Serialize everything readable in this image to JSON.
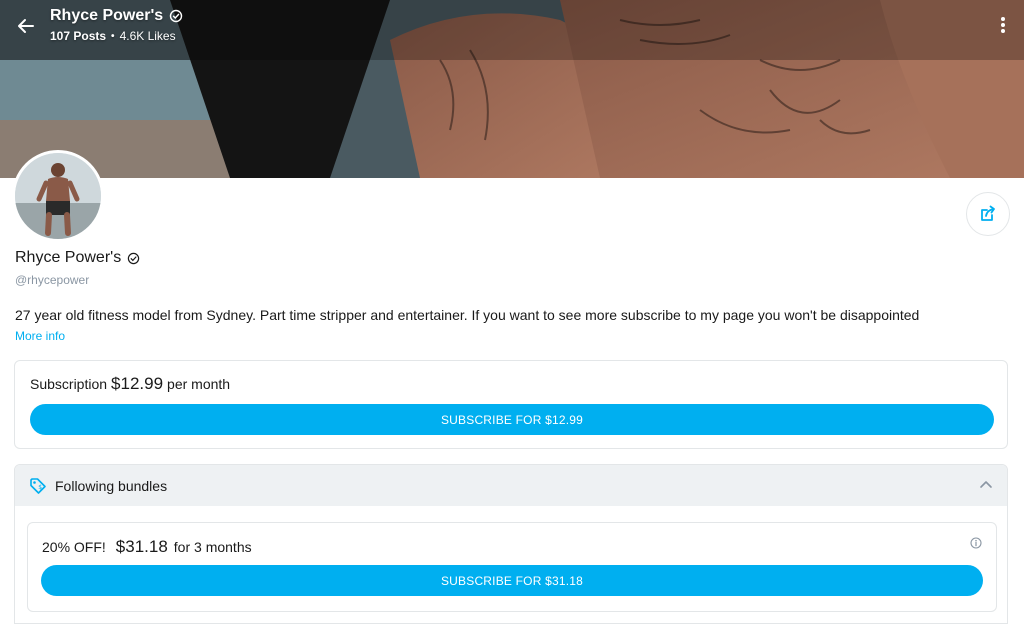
{
  "header": {
    "title": "Rhyce Power's",
    "posts": "107 Posts",
    "likes": "4.6K Likes",
    "separator": "•"
  },
  "profile": {
    "name": "Rhyce Power's",
    "handle": "@rhycepower",
    "bio": "27 year old fitness model from Sydney. Part time stripper and entertainer. If you want to see more subscribe to my page you won't be disappointed",
    "more_info": "More info"
  },
  "subscription": {
    "label": "Subscription",
    "price": "$12.99",
    "period": "per month",
    "button": "SUBSCRIBE FOR $12.99"
  },
  "bundles": {
    "title": "Following bundles",
    "items": [
      {
        "discount": "20% OFF!",
        "price": "$31.18",
        "duration": "for 3 months",
        "button": "SUBSCRIBE FOR $31.18"
      }
    ]
  },
  "colors": {
    "accent": "#00aff0",
    "text": "#1a1a1a",
    "muted": "#8a96a3",
    "border": "#e3e6e8",
    "panel": "#eef1f3"
  },
  "icons": [
    "arrow-left-icon",
    "verified-icon",
    "more-vertical-icon",
    "share-icon",
    "price-tag-icon",
    "chevron-up-icon",
    "info-icon"
  ]
}
